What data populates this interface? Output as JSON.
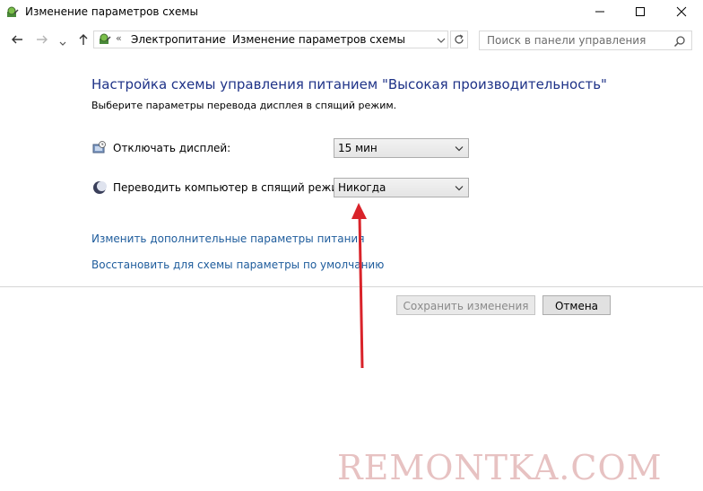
{
  "window": {
    "title": "Изменение параметров схемы"
  },
  "address_bar": {
    "overflow_glyph": "«",
    "crumbs": [
      "Электропитание",
      "Изменение параметров схемы"
    ],
    "separator": "›"
  },
  "search": {
    "placeholder": "Поиск в панели управления"
  },
  "main": {
    "title": "Настройка схемы управления питанием \"Высокая производительность\"",
    "subtitle": "Выберите параметры перевода дисплея в спящий режим.",
    "display_off": {
      "label": "Отключать дисплей:",
      "value": "15 мин"
    },
    "sleep": {
      "label": "Переводить компьютер в спящий режим:",
      "value": "Никогда"
    },
    "links": {
      "advanced": "Изменить дополнительные параметры питания",
      "restore": "Восстановить для схемы параметры по умолчанию"
    }
  },
  "buttons": {
    "save": "Сохранить изменения",
    "cancel": "Отмена"
  },
  "watermark": "REMONTKA.COM",
  "colors": {
    "title": "#1e3287",
    "link": "#1e5c9c",
    "annotation_arrow": "#d9232a"
  }
}
